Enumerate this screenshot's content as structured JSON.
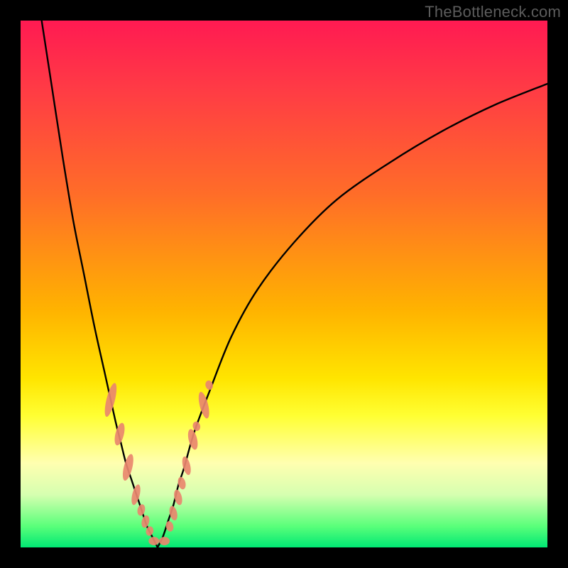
{
  "watermark": "TheBottleneck.com",
  "colors": {
    "frame": "#000000",
    "curve": "#000000",
    "highlight": "#e9876e"
  },
  "chart_data": {
    "type": "line",
    "title": "",
    "xlabel": "",
    "ylabel": "",
    "xlim": [
      0,
      100
    ],
    "ylim": [
      0,
      100
    ],
    "series": [
      {
        "name": "left-branch",
        "x": [
          4,
          6,
          8,
          10,
          12,
          14,
          16,
          18,
          19,
          20,
          21,
          22,
          23,
          24,
          25,
          26
        ],
        "y": [
          100,
          87,
          74,
          62,
          52,
          42,
          33,
          24,
          20,
          16,
          13,
          10,
          7,
          4,
          2,
          0
        ]
      },
      {
        "name": "right-branch",
        "x": [
          26,
          27,
          28,
          29,
          30,
          31,
          33,
          36,
          40,
          45,
          52,
          60,
          70,
          80,
          90,
          100
        ],
        "y": [
          0,
          2,
          5,
          8,
          12,
          15,
          22,
          30,
          40,
          49,
          58,
          66,
          73,
          79,
          84,
          88
        ]
      }
    ],
    "highlight_segments": [
      {
        "branch": "left",
        "y_from": 32,
        "y_to": 4
      },
      {
        "branch": "right",
        "y_from": 4,
        "y_to": 32
      }
    ],
    "highlight_ellipses_left": [
      {
        "cx": 17.1,
        "cy": 28.0,
        "rx": 0.8,
        "ry": 3.3
      },
      {
        "cx": 18.8,
        "cy": 21.5,
        "rx": 0.8,
        "ry": 2.2
      },
      {
        "cx": 20.4,
        "cy": 15.2,
        "rx": 0.8,
        "ry": 2.6
      },
      {
        "cx": 21.9,
        "cy": 10.0,
        "rx": 0.7,
        "ry": 2.0
      },
      {
        "cx": 22.9,
        "cy": 7.1,
        "rx": 0.7,
        "ry": 1.1
      },
      {
        "cx": 23.7,
        "cy": 4.9,
        "rx": 0.7,
        "ry": 1.2
      },
      {
        "cx": 24.5,
        "cy": 3.1,
        "rx": 0.7,
        "ry": 0.9
      }
    ],
    "highlight_ellipses_bottom": [
      {
        "cx": 25.3,
        "cy": 1.2,
        "rx": 1.0,
        "ry": 0.8
      },
      {
        "cx": 27.3,
        "cy": 1.2,
        "rx": 1.0,
        "ry": 0.8
      }
    ],
    "highlight_ellipses_right": [
      {
        "cx": 28.3,
        "cy": 4.0,
        "rx": 0.7,
        "ry": 1.0
      },
      {
        "cx": 29.0,
        "cy": 6.5,
        "rx": 0.7,
        "ry": 1.4
      },
      {
        "cx": 29.9,
        "cy": 9.5,
        "rx": 0.7,
        "ry": 1.5
      },
      {
        "cx": 30.6,
        "cy": 12.2,
        "rx": 0.7,
        "ry": 1.2
      },
      {
        "cx": 31.5,
        "cy": 15.5,
        "rx": 0.7,
        "ry": 1.8
      },
      {
        "cx": 32.7,
        "cy": 20.5,
        "rx": 0.8,
        "ry": 2.0
      },
      {
        "cx": 33.4,
        "cy": 23.0,
        "rx": 0.7,
        "ry": 0.9
      },
      {
        "cx": 34.8,
        "cy": 27.0,
        "rx": 0.8,
        "ry": 2.6
      },
      {
        "cx": 35.8,
        "cy": 30.8,
        "rx": 0.7,
        "ry": 0.9
      }
    ]
  }
}
